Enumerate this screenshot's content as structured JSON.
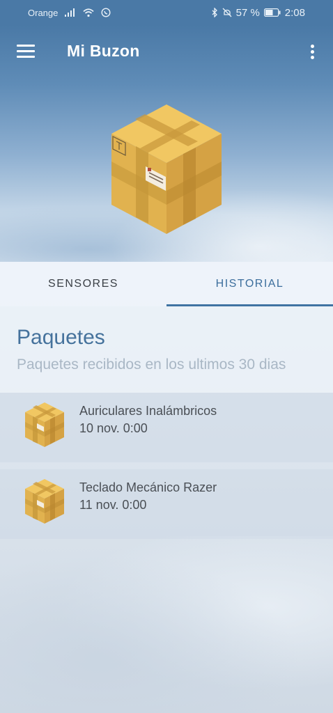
{
  "status_bar": {
    "carrier": "Orange",
    "signal_icon": "signal-icon",
    "wifi_icon": "wifi-icon",
    "whatsapp_icon": "whatsapp-icon",
    "bluetooth_icon": "bluetooth-icon",
    "mute_icon": "mute-icon",
    "battery_percent": "57 %",
    "battery_icon": "battery-icon",
    "time": "2:08"
  },
  "app_bar": {
    "title": "Mi Buzon",
    "menu_icon": "menu-icon",
    "more_icon": "more-vert-icon"
  },
  "tabs": [
    {
      "label": "SENSORES",
      "selected": false
    },
    {
      "label": "HISTORIAL",
      "selected": true
    }
  ],
  "section": {
    "title": "Paquetes",
    "subtitle": "Paquetes recibidos en los ultimos 30 dias"
  },
  "packages": [
    {
      "name": "Auriculares Inalámbricos",
      "date": "10 nov. 0:00",
      "icon": "package-icon"
    },
    {
      "name": "Teclado Mecánico Razer",
      "date": "11 nov. 0:00",
      "icon": "package-icon"
    }
  ],
  "colors": {
    "primary": "#4a79a6",
    "accent": "#3f73a2",
    "box": "#e8b84f"
  }
}
